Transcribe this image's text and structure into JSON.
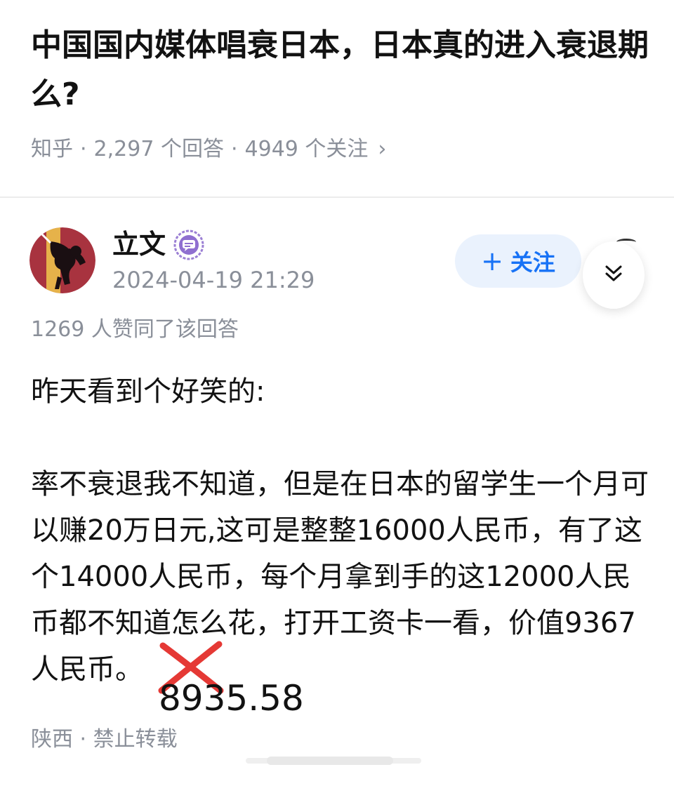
{
  "question": {
    "title": "中国国内媒体唱衰日本，日本真的进入衰退期么?",
    "source": "知乎",
    "answers_count": "2,297 个回答",
    "follow_count": "4949 个关注"
  },
  "answer": {
    "author_name": "立文",
    "timestamp": "2024-04-19 21:29",
    "follow_button_label": "关注",
    "votes_text": "1269 人赞同了该回答",
    "paragraph_1": "昨天看到个好笑的:",
    "paragraph_2_part_1": "率不衰退我不知道，但是在日本的留学生一个月可以赚20万日元,这可是整整16000人民币，有了这个14000人民币，每个月拿到手的这12000人民币都不知道怎么花，打开工资卡一看，价值",
    "struck_value": "9367",
    "paragraph_2_part_2": "人民币。",
    "handwritten_correction": "8935.58",
    "location": "陕西",
    "repost_policy": "禁止转载"
  },
  "colors": {
    "accent": "#1772f6",
    "follow_bg": "#eaf2fd",
    "meta_gray": "#8a8f99",
    "cross_red": "#e53935",
    "avatar_bg": "#a8333f"
  },
  "icons": {
    "badge": "chat-bubble-badge-icon",
    "collapse": "double-chevron-down-icon",
    "meta_more": "chevron-right-icon"
  }
}
